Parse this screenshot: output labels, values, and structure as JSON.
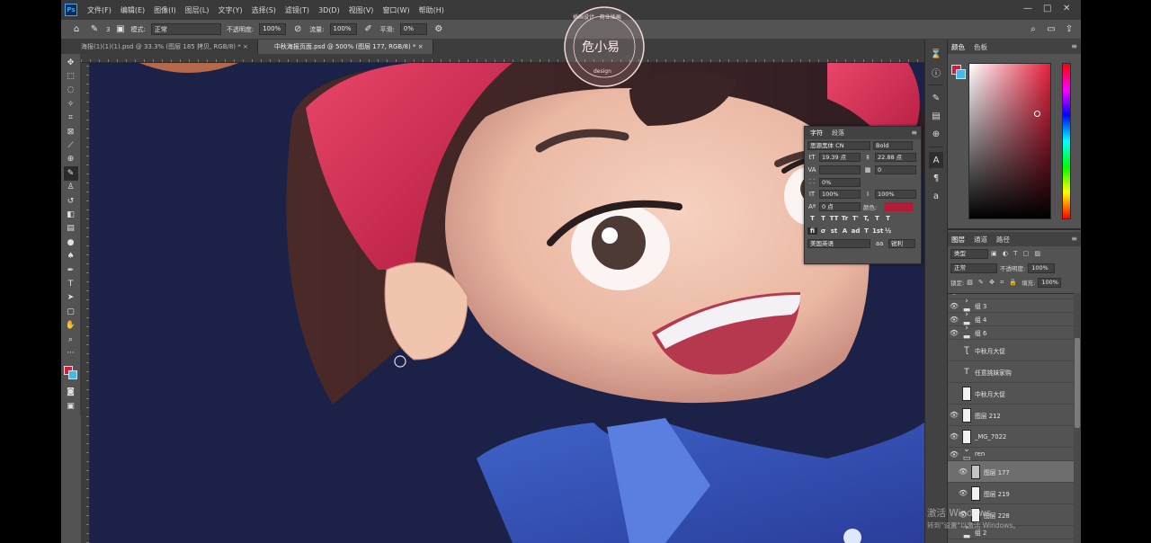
{
  "app": {
    "logo": "Ps",
    "menus": [
      "文件(F)",
      "编辑(E)",
      "图像(I)",
      "图层(L)",
      "文字(Y)",
      "选择(S)",
      "滤镜(T)",
      "3D(D)",
      "视图(V)",
      "窗口(W)",
      "帮助(H)"
    ],
    "window_controls": [
      "—",
      "□",
      "✕"
    ]
  },
  "options_bar": {
    "mode_label": "模式:",
    "mode_value": "正常",
    "opacity_label": "不透明度:",
    "opacity_value": "100%",
    "flow_label": "流量:",
    "flow_value": "100%",
    "smoothing_label": "平滑:",
    "smoothing_value": "0%",
    "brush_size": "3"
  },
  "tabs": [
    {
      "label": "海报(1)(1)(1).psd @ 33.3% (图层 185 拷贝, RGB/8) *",
      "close": "×"
    },
    {
      "label": "中秋海报页面.psd @ 500% (图层 177, RGB/8) *",
      "close": "×"
    }
  ],
  "tools": [
    "move-tool",
    "marquee-tool",
    "lasso-tool",
    "magic-wand-tool",
    "crop-tool",
    "frame-tool",
    "eyedropper-tool",
    "healing-brush-tool",
    "brush-tool",
    "clone-stamp-tool",
    "history-brush-tool",
    "eraser-tool",
    "gradient-tool",
    "blur-tool",
    "dodge-tool",
    "pen-tool",
    "type-tool",
    "path-selection-tool",
    "direct-selection-tool",
    "rectangle-tool",
    "hand-tool",
    "zoom-tool",
    "more-tools"
  ],
  "colors": {
    "foreground": "#cf1f3d",
    "background": "#49b8e6",
    "canvas_bg": "#1c2247",
    "panel_bg": "#535353",
    "panel_dark": "#424242",
    "text_color_swatch": "#b21c36"
  },
  "character_panel": {
    "tabs": [
      "字符",
      "段落"
    ],
    "font_family": "思源黑体 CN",
    "font_style": "Bold",
    "font_size": "19.39 点",
    "leading": "22.88 点",
    "kerning": "",
    "tracking": "0",
    "scale_percent": "0%",
    "vertical_scale": "100%",
    "horizontal_scale": "100%",
    "baseline_shift": "0 点",
    "color_label": "颜色:",
    "style_buttons": [
      "T",
      "T",
      "TT",
      "Tr",
      "T'",
      "T,",
      "T",
      "T"
    ],
    "opentype_buttons": [
      "fi",
      "σ",
      "st",
      "A",
      "ad",
      "T",
      "1st",
      "½"
    ],
    "language": "美国英语",
    "antialias": "锐利",
    "aa_icon": "aa"
  },
  "color_panel": {
    "tabs": [
      "颜色",
      "色板"
    ]
  },
  "layers_panel": {
    "tabs": [
      "图层",
      "通道",
      "路径"
    ],
    "filter_label": "类型",
    "blend_mode": "正常",
    "opacity_label": "不透明度:",
    "opacity_value": "100%",
    "lock_label": "锁定:",
    "fill_label": "填充:",
    "fill_value": "100%",
    "layers": [
      {
        "name": "组 3",
        "kind": "group",
        "visible": true
      },
      {
        "name": "组 4",
        "kind": "group",
        "visible": true
      },
      {
        "name": "组 6",
        "kind": "group",
        "visible": true
      },
      {
        "name": "中秋月大促",
        "kind": "warp-text",
        "visible": false
      },
      {
        "name": "任意挑妹家购",
        "kind": "text",
        "visible": false
      },
      {
        "name": "中秋月大促",
        "kind": "pixel",
        "visible": false
      },
      {
        "name": "图层 212",
        "kind": "pixel",
        "visible": true
      },
      {
        "name": "_MG_7022",
        "kind": "pixel",
        "visible": true
      },
      {
        "name": "ren",
        "kind": "group",
        "visible": true
      },
      {
        "name": "图层 177",
        "kind": "pixel",
        "visible": true,
        "selected": true
      },
      {
        "name": "图层 219",
        "kind": "pixel",
        "visible": true
      },
      {
        "name": "图层 228",
        "kind": "pixel",
        "visible": true
      },
      {
        "name": "组 2",
        "kind": "group",
        "visible": false
      }
    ]
  },
  "watermark": {
    "title": "激活 Windows",
    "subtitle": "转到\"设置\"以激活 Windows。"
  },
  "stamp": {
    "center": "危小易",
    "ring_top": "插画设计 · 商业插画",
    "bottom": "design"
  }
}
